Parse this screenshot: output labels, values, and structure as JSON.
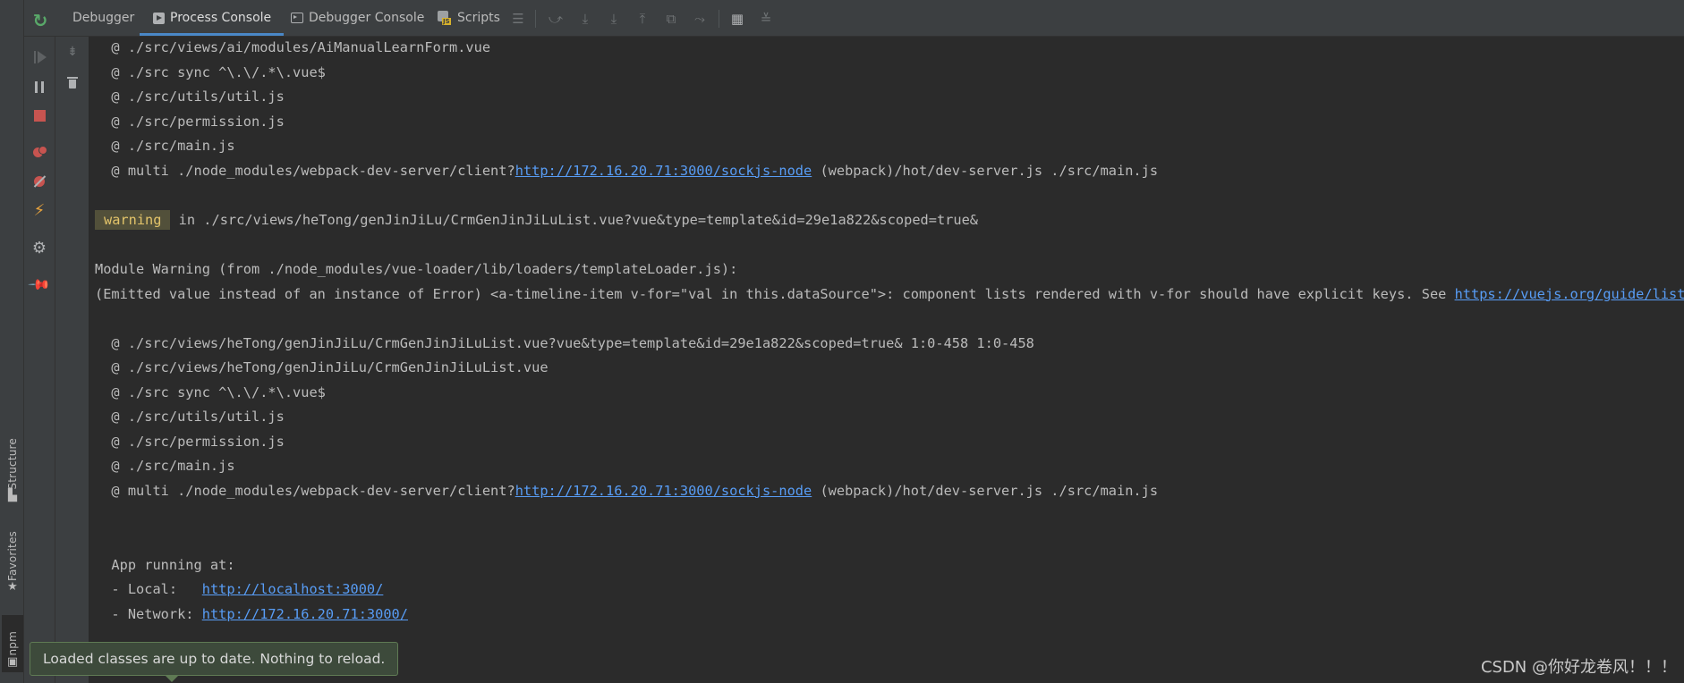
{
  "tabs": [
    {
      "label": "Debugger",
      "active": false
    },
    {
      "label": "Process Console",
      "active": true
    },
    {
      "label": "Debugger Console",
      "active": false
    },
    {
      "label": "Scripts",
      "active": false
    }
  ],
  "side_tabs": [
    {
      "label": "Structure",
      "icon": "structure-icon"
    },
    {
      "label": "Favorites",
      "icon": "star-icon"
    },
    {
      "label": "npm",
      "icon": "npm-icon"
    }
  ],
  "console": {
    "lines": [
      {
        "text": "  @ ./src/views/ai/modules/AiManualLearnForm.vue"
      },
      {
        "text": "  @ ./src sync ^\\.\\/.*\\.vue$"
      },
      {
        "text": "  @ ./src/utils/util.js"
      },
      {
        "text": "  @ ./src/permission.js"
      },
      {
        "text": "  @ ./src/main.js"
      },
      {
        "text": "  @ multi ./node_modules/webpack-dev-server/client?",
        "link": "http://172.16.20.71:3000/sockjs-node",
        "after": " (webpack)/hot/dev-server.js ./src/main.js"
      },
      {
        "text": ""
      },
      {
        "badge": "warning",
        "text": " in ./src/views/heTong/genJinJiLu/CrmGenJinJiLuList.vue?vue&type=template&id=29e1a822&scoped=true&"
      },
      {
        "text": ""
      },
      {
        "text": "Module Warning (from ./node_modules/vue-loader/lib/loaders/templateLoader.js):"
      },
      {
        "text": "(Emitted value instead of an instance of Error) <a-timeline-item v-for=\"val in this.dataSource\">: component lists rendered with v-for should have explicit keys. See ",
        "link": "https://vuejs.org/guide/list.html#key",
        "after": ""
      },
      {
        "text": ""
      },
      {
        "text": "  @ ./src/views/heTong/genJinJiLu/CrmGenJinJiLuList.vue?vue&type=template&id=29e1a822&scoped=true& 1:0-458 1:0-458"
      },
      {
        "text": "  @ ./src/views/heTong/genJinJiLu/CrmGenJinJiLuList.vue"
      },
      {
        "text": "  @ ./src sync ^\\.\\/.*\\.vue$"
      },
      {
        "text": "  @ ./src/utils/util.js"
      },
      {
        "text": "  @ ./src/permission.js"
      },
      {
        "text": "  @ ./src/main.js"
      },
      {
        "text": "  @ multi ./node_modules/webpack-dev-server/client?",
        "link": "http://172.16.20.71:3000/sockjs-node",
        "after": " (webpack)/hot/dev-server.js ./src/main.js"
      },
      {
        "text": ""
      },
      {
        "text": ""
      },
      {
        "text": "  App running at:"
      },
      {
        "text": "  - Local:   ",
        "link": "http://localhost:3000/",
        "after": ""
      },
      {
        "text": "  - Network: ",
        "link": "http://172.16.20.71:3000/",
        "after": ""
      }
    ]
  },
  "notification": {
    "text": "Loaded classes are up to date. Nothing to reload."
  },
  "watermark": "CSDN @你好龙卷风！！！",
  "colors": {
    "link": "#589df6",
    "warning_bg": "#52503a",
    "warning_fg": "#e3c46a",
    "accent": "#4a88c7"
  }
}
